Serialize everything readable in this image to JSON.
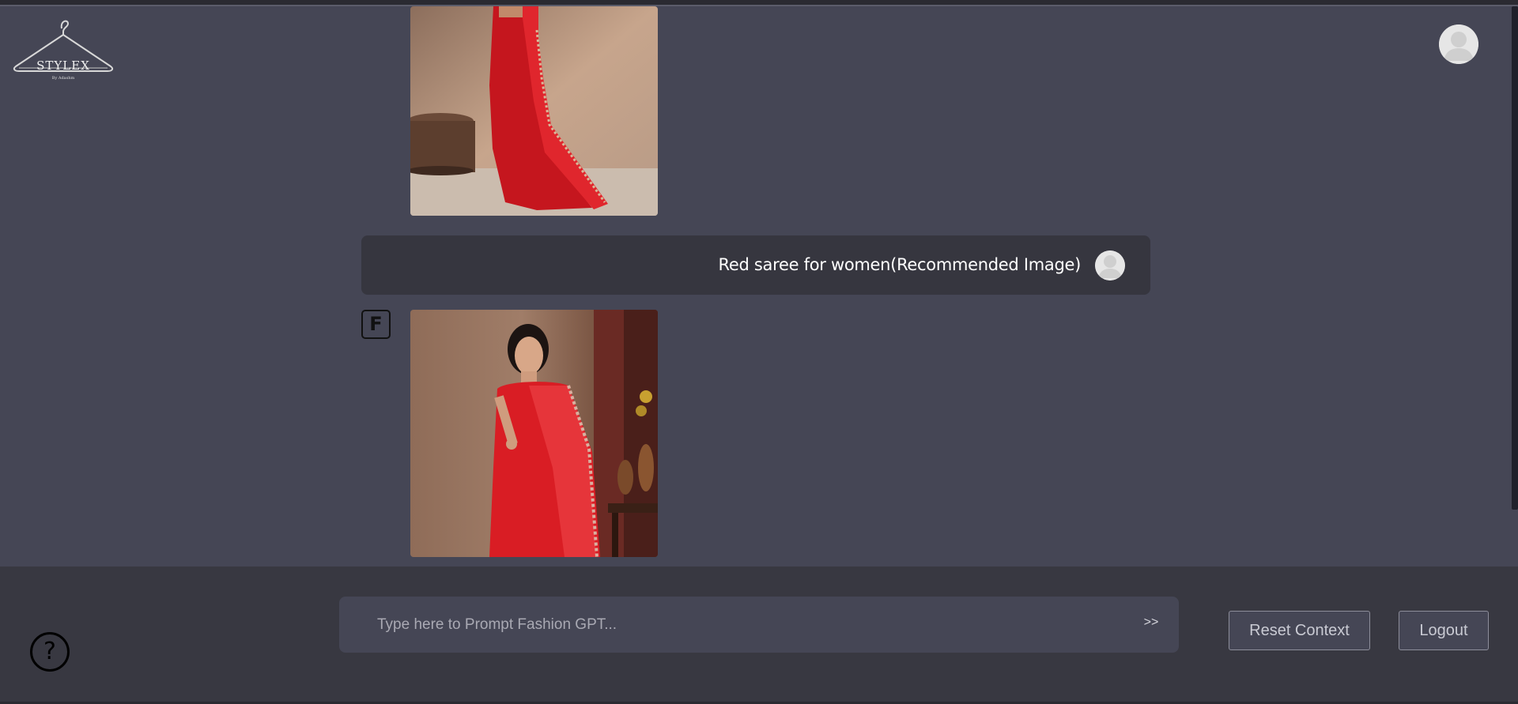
{
  "brand": {
    "logo_text": "STYLEX",
    "logo_subtext": "By Adashm"
  },
  "chat": {
    "messages": [
      {
        "role": "bot",
        "type": "image",
        "icon": "saree-image-1"
      },
      {
        "role": "user",
        "type": "text",
        "text": "Red saree for women(Recommended Image)"
      },
      {
        "role": "bot",
        "type": "image",
        "badge": "F",
        "icon": "saree-image-2"
      }
    ]
  },
  "composer": {
    "placeholder": "Type here to Prompt Fashion GPT...",
    "send_label": ">>"
  },
  "actions": {
    "reset_label": "Reset Context",
    "logout_label": "Logout",
    "help_label": "?"
  },
  "colors": {
    "background": "#454655",
    "panel": "#36363f",
    "bottom_bar": "#383841",
    "accent_red": "#d91d24"
  }
}
